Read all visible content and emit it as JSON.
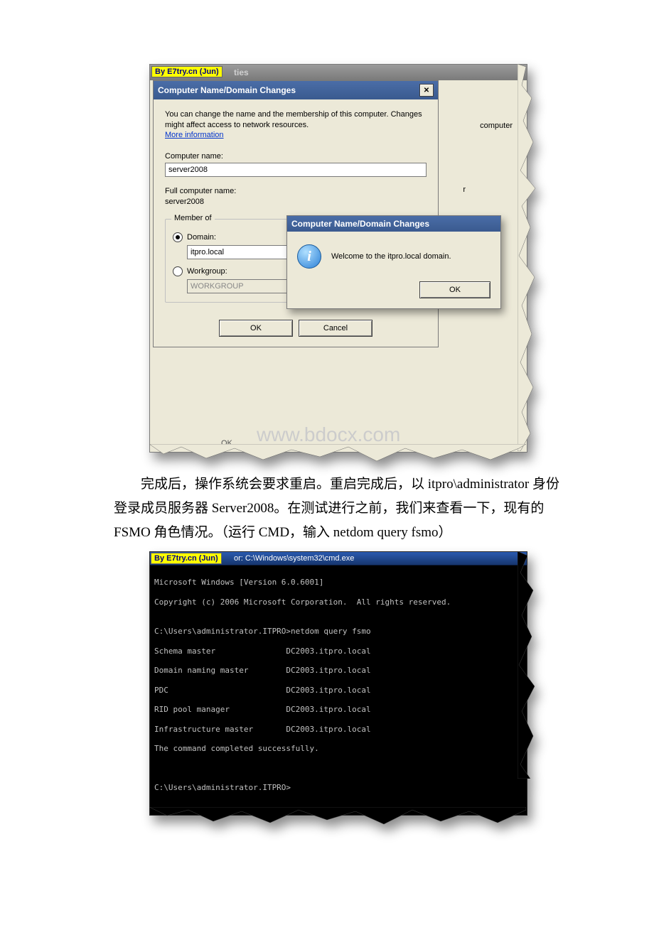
{
  "badge": "By E7try.cn (Jun)",
  "bg_title_suffix": "ties",
  "bg_right_label": "computer",
  "bg_right_char": "r",
  "dialog1": {
    "title": "Computer Name/Domain Changes",
    "desc": "You can change the name and the membership of this computer. Changes might affect access to network resources.",
    "more_info": "More information",
    "computer_name_label": "Computer name:",
    "computer_name_value": "server2008",
    "full_name_label": "Full computer name:",
    "full_name_value": "server2008",
    "member_of": "Member of",
    "domain_label": "Domain:",
    "domain_value": "itpro.local",
    "workgroup_label": "Workgroup:",
    "workgroup_value": "WORKGROUP",
    "ok": "OK",
    "cancel": "Cancel"
  },
  "bg_ok1": "OK",
  "msgbox": {
    "title": "Computer Name/Domain Changes",
    "text": "Welcome to the itpro.local domain.",
    "ok": "OK"
  },
  "paragraph": "完成后，操作系统会要求重启。重启完成后，以 itpro\\administrator 身份登录成员服务器 Server2008。在测试进行之前，我们来查看一下，现有的 FSMO 角色情况。（运行 CMD，输入 netdom query fsmo）",
  "cmd": {
    "title_path": "C:\\Windows\\system32\\cmd.exe",
    "title_prefix": "or:",
    "lines": [
      "Microsoft Windows [Version 6.0.6001]",
      "Copyright (c) 2006 Microsoft Corporation.  All rights reserved.",
      "",
      "C:\\Users\\administrator.ITPRO>netdom query fsmo",
      "Schema master               DC2003.itpro.local",
      "Domain naming master        DC2003.itpro.local",
      "PDC                         DC2003.itpro.local",
      "RID pool manager            DC2003.itpro.local",
      "Infrastructure master       DC2003.itpro.local",
      "The command completed successfully.",
      "",
      "",
      "C:\\Users\\administrator.ITPRO>"
    ]
  }
}
